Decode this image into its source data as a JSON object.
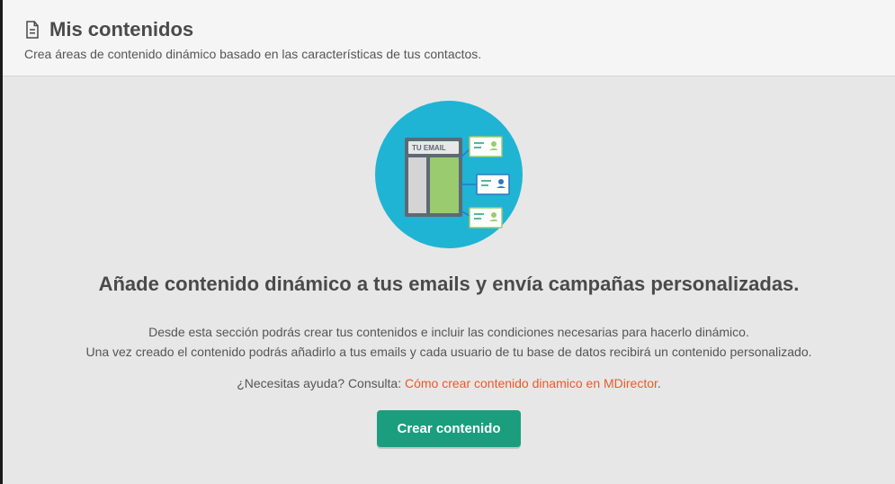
{
  "header": {
    "title": "Mis contenidos",
    "subtitle": "Crea áreas de contenido dinámico basado en las características de tus contactos."
  },
  "illustration": {
    "label": "TU EMAIL",
    "icon_name": "dynamic-email-illustration"
  },
  "main": {
    "headline": "Añade contenido dinámico a tus emails y envía campañas personalizadas.",
    "description_line1": "Desde esta sección podrás crear tus contenidos e incluir las condiciones necesarias para hacerlo dinámico.",
    "description_line2": "Una vez creado el contenido podrás añadirlo a tus emails y cada usuario de tu base de datos recibirá un contenido personalizado.",
    "help_prefix": "¿Necesitas ayuda? Consulta: ",
    "help_link_text": "Cómo crear contenido dinamico en MDirector",
    "help_suffix": ".",
    "cta_label": "Crear contenido"
  },
  "colors": {
    "accent_teal": "#1a9e7e",
    "link": "#e85a2a",
    "circle": "#1fb4d4"
  }
}
